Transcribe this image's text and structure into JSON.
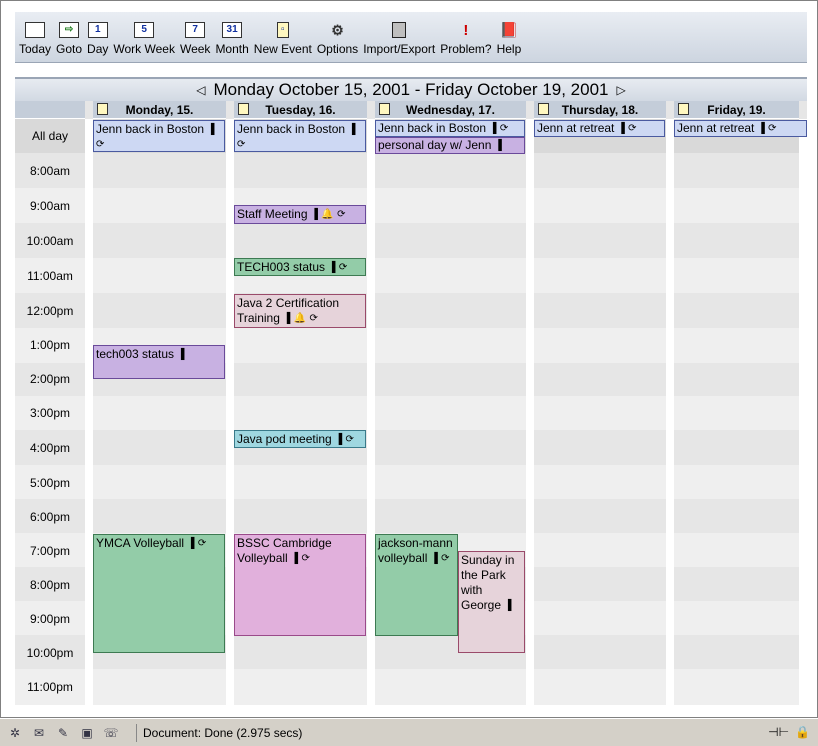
{
  "toolbar": {
    "items": [
      {
        "label": "Today",
        "icon": "today-calendar-icon",
        "glyph": ""
      },
      {
        "label": "Goto",
        "icon": "goto-arrow-icon",
        "glyph": "⇨"
      },
      {
        "label": "Day",
        "icon": "day-1-icon",
        "glyph": "1"
      },
      {
        "label": "Work Week",
        "icon": "workweek-5-icon",
        "glyph": "5"
      },
      {
        "label": "Week",
        "icon": "week-7-icon",
        "glyph": "7"
      },
      {
        "label": "Month",
        "icon": "month-31-icon",
        "glyph": "31"
      },
      {
        "label": "New Event",
        "icon": "new-event-icon",
        "glyph": "▫"
      },
      {
        "label": "Options",
        "icon": "options-icon",
        "glyph": "⚙"
      },
      {
        "label": "Import/Export",
        "icon": "disk-icon",
        "glyph": ""
      },
      {
        "label": "Problem?",
        "icon": "exclamation-icon",
        "glyph": "!"
      },
      {
        "label": "Help",
        "icon": "help-book-icon",
        "glyph": "📕"
      }
    ]
  },
  "nav": {
    "prev_glyph": "◁",
    "next_glyph": "▷",
    "range": "Monday October 15, 2001 - Friday October 19, 2001"
  },
  "days": [
    "Monday, 15.",
    "Tuesday, 16.",
    "Wednesday, 17.",
    "Thursday, 18.",
    "Friday, 19."
  ],
  "times": [
    "All day",
    "8:00am",
    "9:00am",
    "10:00am",
    "11:00am",
    "12:00pm",
    "1:00pm",
    "2:00pm",
    "3:00pm",
    "4:00pm",
    "5:00pm",
    "6:00pm",
    "7:00pm",
    "8:00pm",
    "9:00pm",
    "10:00pm",
    "11:00pm"
  ],
  "icons": {
    "owner": "▐",
    "repeat": "⟳",
    "alarm": "🔔"
  },
  "events": {
    "mon_allday": "Jenn back in Boston",
    "tue_allday": "Jenn back in Boston",
    "wed_allday": "Jenn back in Boston",
    "wed_allday2": "personal day w/ Jenn",
    "thu_allday": "Jenn at retreat",
    "fri_allday": "Jenn at retreat",
    "tue_staff": "Staff Meeting",
    "tue_tech003": "TECH003 status",
    "tue_java2": "Java 2 Certification Training",
    "mon_tech003": "tech003 status",
    "tue_javapod": "Java pod meeting",
    "mon_ymca": "YMCA Volleyball",
    "tue_bssc": "BSSC Cambridge Volleyball",
    "wed_jackson": "jackson-mann volleyball",
    "wed_sunday": "Sunday in the Park with George"
  },
  "status": {
    "text": "Document: Done (2.975 secs)"
  },
  "colors": {
    "allday_blue": "#cdd8f3",
    "meeting_purple": "#c8b1e2",
    "status_green": "#93cca8",
    "volleyball_pink": "#e1b0dc",
    "rose": "#e6d3da",
    "pod_cyan": "#9fd7e0"
  }
}
